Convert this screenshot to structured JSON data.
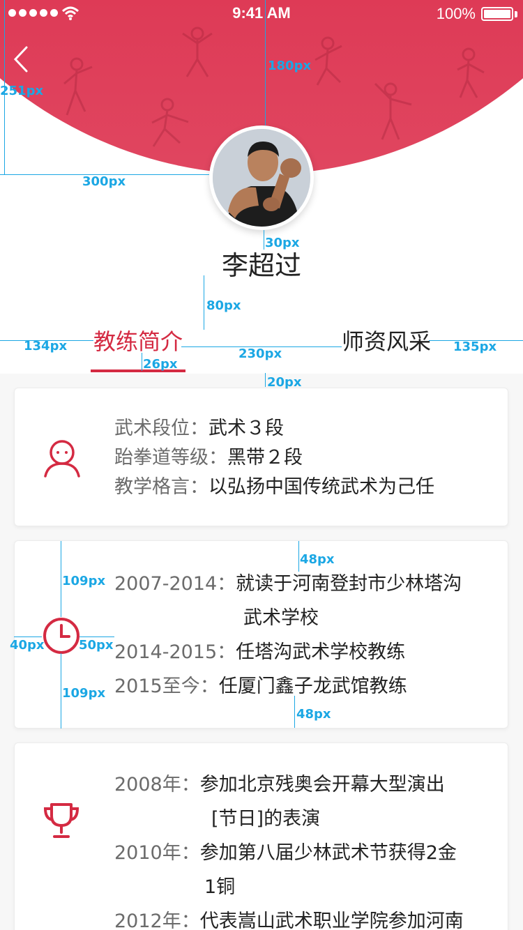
{
  "status_bar": {
    "time": "9:41 AM",
    "battery": "100%"
  },
  "profile": {
    "name": "李超过"
  },
  "tabs": [
    {
      "label": "教练简介"
    },
    {
      "label": "师资风采"
    }
  ],
  "info": {
    "rows": [
      {
        "label": "武术段位：",
        "value": "武术３段"
      },
      {
        "label": "跆拳道等级：",
        "value": "黑带２段"
      },
      {
        "label": "教学格言：",
        "value": "以弘扬中国传统武术为己任"
      }
    ]
  },
  "history": {
    "rows": [
      {
        "label": "2007-2014：",
        "value": "就读于河南登封市少林塔沟",
        "cont": "武术学校"
      },
      {
        "label": "2014-2015：",
        "value": "任塔沟武术学校教练"
      },
      {
        "label": "2015至今：",
        "value": "任厦门鑫子龙武馆教练"
      }
    ]
  },
  "awards": {
    "rows": [
      {
        "label": "2008年：",
        "value": "参加北京残奥会开幕大型演出",
        "cont": "[节日]的表演"
      },
      {
        "label": "2010年：",
        "value": "参加第八届少林武术节获得2金",
        "cont": "1铜"
      },
      {
        "label": "2012年：",
        "value": "代表嵩山武术职业学院参加河南"
      }
    ]
  },
  "annotations": {
    "a1": "251px",
    "a2": "180px",
    "a3": "300px",
    "a4": "30px",
    "a5": "80px",
    "a6": "134px",
    "a7": "26px",
    "a8": "230px",
    "a9": "135px",
    "a10": "20px",
    "a11": "48px",
    "a12": "109px",
    "a13": "40px",
    "a14": "50px",
    "a15": "109px",
    "a16": "48px"
  },
  "colors": {
    "accent": "#d42a42",
    "annotation": "#1ba7e4"
  }
}
